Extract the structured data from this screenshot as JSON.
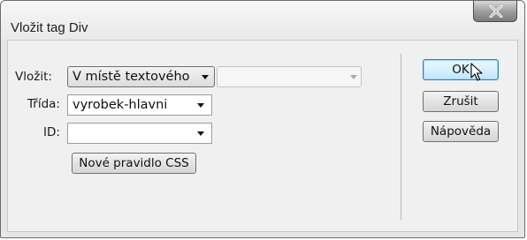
{
  "window": {
    "title": "Vložit tag Div",
    "close_icon": "close-x-icon"
  },
  "form": {
    "insert": {
      "label": "Vložit:",
      "selected": "V místě textového",
      "secondary_value": ""
    },
    "class": {
      "label": "Třída:",
      "value": "vyrobek-hlavni"
    },
    "id": {
      "label": "ID:",
      "value": ""
    },
    "new_css_rule_label": "Nové pravidlo CSS"
  },
  "buttons": {
    "ok": "OK",
    "cancel": "Zrušit",
    "help": "Nápověda"
  },
  "colors": {
    "ok_border": "#3c7fb1",
    "ok_fill": "#d9f0fc"
  }
}
